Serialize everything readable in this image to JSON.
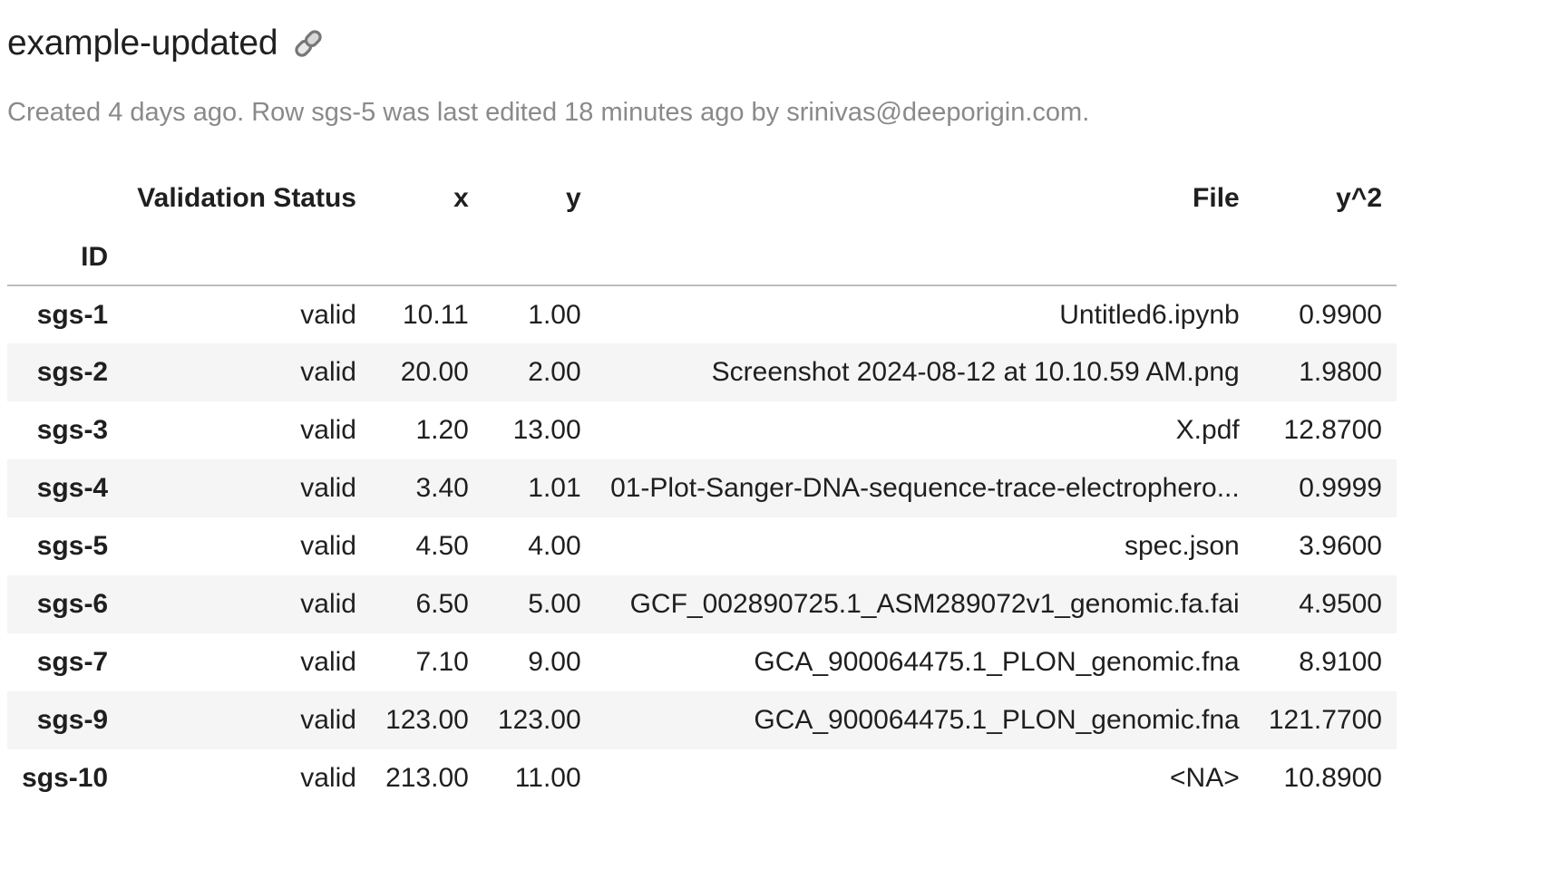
{
  "header": {
    "title": "example-updated",
    "subtitle": "Created 4 days ago. Row sgs-5 was last edited 18 minutes ago by srinivas@deeporigin.com."
  },
  "icons": {
    "title_link": "link-icon"
  },
  "table": {
    "index_name": "ID",
    "columns": [
      "Validation Status",
      "x",
      "y",
      "File",
      "y^2"
    ],
    "rows": [
      {
        "id": "sgs-1",
        "status": "valid",
        "x": "10.11",
        "y": "1.00",
        "file": "Untitled6.ipynb",
        "y2": "0.9900"
      },
      {
        "id": "sgs-2",
        "status": "valid",
        "x": "20.00",
        "y": "2.00",
        "file": "Screenshot 2024-08-12 at 10.10.59 AM.png",
        "y2": "1.9800"
      },
      {
        "id": "sgs-3",
        "status": "valid",
        "x": "1.20",
        "y": "13.00",
        "file": "X.pdf",
        "y2": "12.8700"
      },
      {
        "id": "sgs-4",
        "status": "valid",
        "x": "3.40",
        "y": "1.01",
        "file": "01-Plot-Sanger-DNA-sequence-trace-electrophero...",
        "y2": "0.9999"
      },
      {
        "id": "sgs-5",
        "status": "valid",
        "x": "4.50",
        "y": "4.00",
        "file": "spec.json",
        "y2": "3.9600"
      },
      {
        "id": "sgs-6",
        "status": "valid",
        "x": "6.50",
        "y": "5.00",
        "file": "GCF_002890725.1_ASM289072v1_genomic.fa.fai",
        "y2": "4.9500"
      },
      {
        "id": "sgs-7",
        "status": "valid",
        "x": "7.10",
        "y": "9.00",
        "file": "GCA_900064475.1_PLON_genomic.fna",
        "y2": "8.9100"
      },
      {
        "id": "sgs-9",
        "status": "valid",
        "x": "123.00",
        "y": "123.00",
        "file": "GCA_900064475.1_PLON_genomic.fna",
        "y2": "121.7700"
      },
      {
        "id": "sgs-10",
        "status": "valid",
        "x": "213.00",
        "y": "11.00",
        "file": "<NA>",
        "y2": "10.8900"
      }
    ]
  }
}
